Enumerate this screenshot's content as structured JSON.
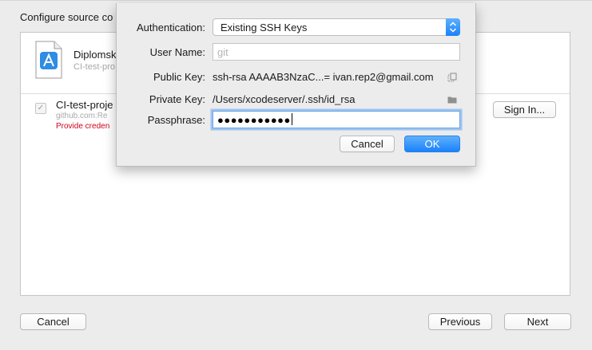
{
  "sheet": {
    "title": "Configure source co"
  },
  "project": {
    "name": "Diplomsk",
    "subtitle": "CI-test-pro",
    "icon": "xcode-project-file-icon"
  },
  "repository": {
    "checked_glyph": "✓",
    "name": "CI-test-proje",
    "host": "github.com:Re",
    "warning": "Provide creden",
    "sign_in_label": "Sign In..."
  },
  "footer": {
    "cancel_label": "Cancel",
    "previous_label": "Previous",
    "next_label": "Next"
  },
  "auth_dialog": {
    "authentication_label": "Authentication:",
    "authentication_value": "Existing SSH Keys",
    "username_label": "User Name:",
    "username_placeholder": "git",
    "public_key_label": "Public Key:",
    "public_key_value": "ssh-rsa AAAAB3NzaC...= ivan.rep2@gmail.com",
    "private_key_label": "Private Key:",
    "private_key_value": "/Users/xcodeserver/.ssh/id_rsa",
    "passphrase_label": "Passphrase:",
    "passphrase_value": "●●●●●●●●●●●",
    "cancel_label": "Cancel",
    "ok_label": "OK"
  },
  "colors": {
    "accent": "#1a82fb",
    "warning": "#d0021b"
  }
}
